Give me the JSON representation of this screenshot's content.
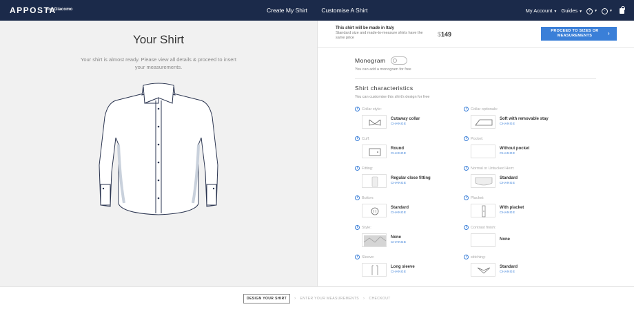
{
  "header": {
    "brand": "APPOSTA",
    "brand_sub": "for Giacomo",
    "nav": [
      "Create My Shirt",
      "Customise A Shirt"
    ],
    "account": "My Account",
    "guides": "Guides",
    "help_icon": "help-circle-icon",
    "language_icon": "globe-icon",
    "bag_icon": "shopping-bag-icon"
  },
  "left": {
    "title": "Your Shirt",
    "description": "Your shirt is almost ready. Please view all details & proceed to insert your measurements."
  },
  "summary": {
    "made_in": "This shirt will be made in Italy",
    "note": "Standard size and made-to-measure shirts have the same price",
    "currency": "$",
    "price": "149",
    "proceed_label": "PROCEED TO SIZES OR MEASUREMENTS",
    "proceed_arrow": "›"
  },
  "monogram": {
    "label": "Monogram",
    "toggle_on": false,
    "subtitle": "You can add a monogram for free"
  },
  "characteristics": {
    "title": "Shirt characteristics",
    "subtitle": "You can customise this shirt's design for free",
    "change_label": "CHANGE",
    "options": [
      {
        "label": "Collar style:",
        "value": "Cutaway collar",
        "changeable": true
      },
      {
        "label": "Collar optionals:",
        "value": "Soft with removable stay",
        "changeable": true
      },
      {
        "label": "Cuff:",
        "value": "Round",
        "changeable": true
      },
      {
        "label": "Pocket:",
        "value": "Without pocket",
        "changeable": true
      },
      {
        "label": "Fitting:",
        "value": "Regular close fitting",
        "changeable": true
      },
      {
        "label": "Normal or Untucked Hem:",
        "value": "Standard",
        "changeable": true
      },
      {
        "label": "Button:",
        "value": "Standard",
        "changeable": true
      },
      {
        "label": "Placket:",
        "value": "With placket",
        "changeable": true
      },
      {
        "label": "Style:",
        "value": "None",
        "changeable": true
      },
      {
        "label": "Contrast finish:",
        "value": "None",
        "changeable": false
      },
      {
        "label": "Sleeve:",
        "value": "Long sleeve",
        "changeable": true
      },
      {
        "label": "stitching:",
        "value": "Standard",
        "changeable": true
      }
    ]
  },
  "steps": {
    "design": "DESIGN YOUR SHIRT",
    "measure": "ENTER YOUR MEASUREMENTS",
    "checkout": "CHECKOUT",
    "separator": "›"
  },
  "colors": {
    "header_bg": "#1b2a4a",
    "accent": "#3a7fd8",
    "left_bg": "#f1f1f1"
  }
}
